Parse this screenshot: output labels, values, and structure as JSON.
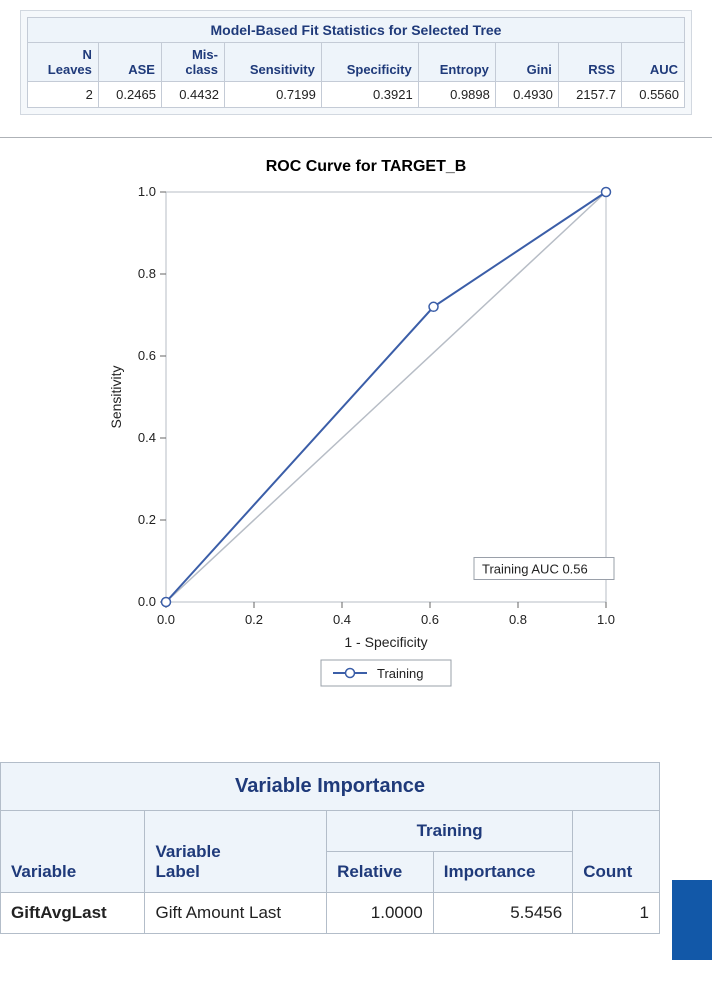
{
  "fit": {
    "title": "Model-Based Fit Statistics for Selected Tree",
    "cols": [
      "N\nLeaves",
      "ASE",
      "Mis-\nclass",
      "Sensitivity",
      "Specificity",
      "Entropy",
      "Gini",
      "RSS",
      "AUC"
    ],
    "row": [
      "2",
      "0.2465",
      "0.4432",
      "0.7199",
      "0.3921",
      "0.9898",
      "0.4930",
      "2157.7",
      "0.5560"
    ]
  },
  "chart_data": {
    "type": "line",
    "title": "ROC Curve for TARGET_B",
    "xlabel": "1 - Specificity",
    "ylabel": "Sensitivity",
    "xlim": [
      0.0,
      1.0
    ],
    "ylim": [
      0.0,
      1.0
    ],
    "x_ticks": [
      0.0,
      0.2,
      0.4,
      0.6,
      0.8,
      1.0
    ],
    "y_ticks": [
      0.0,
      0.2,
      0.4,
      0.6,
      0.8,
      1.0
    ],
    "series": [
      {
        "name": "Training",
        "x": [
          0.0,
          0.608,
          1.0
        ],
        "y": [
          0.0,
          0.72,
          1.0
        ]
      }
    ],
    "reference_line": {
      "x": [
        0.0,
        1.0
      ],
      "y": [
        0.0,
        1.0
      ]
    },
    "annotation": "Training AUC  0.56",
    "legend": [
      "Training"
    ]
  },
  "varimp": {
    "title": "Variable Importance",
    "h_variable": "Variable",
    "h_label": "Variable\nLabel",
    "h_training": "Training",
    "h_relative": "Relative",
    "h_importance": "Importance",
    "h_count": "Count",
    "rows": [
      {
        "variable": "GiftAvgLast",
        "label": "Gift Amount Last",
        "relative": "1.0000",
        "importance": "5.5456",
        "count": "1"
      }
    ]
  }
}
